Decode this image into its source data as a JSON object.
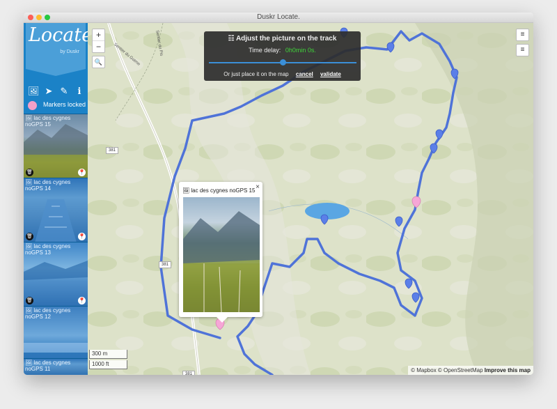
{
  "window": {
    "title": "Duskr Locate."
  },
  "sidebar": {
    "logo_text": "Locate.",
    "logo_by": "by Duskr",
    "tools": [
      {
        "icon": "image-icon",
        "glyph": "🖼"
      },
      {
        "icon": "navigation-icon",
        "glyph": "➤"
      },
      {
        "icon": "pencil-icon",
        "glyph": "✎"
      },
      {
        "icon": "info-icon",
        "glyph": "ℹ"
      }
    ],
    "lock_label": "Markers locked",
    "photos": [
      {
        "caption": "🖼 lac des cygnes noGPS 15"
      },
      {
        "caption": "🖼 lac des cygnes noGPS 14"
      },
      {
        "caption": "🖼 lac des cygnes noGPS 13"
      },
      {
        "caption": "🖼 lac des cygnes noGPS 12"
      },
      {
        "caption": "🖼 lac des cygnes noGPS 11"
      }
    ]
  },
  "map": {
    "zoom_in": "+",
    "zoom_out": "−",
    "search_glyph": "🔍",
    "layer_glyph": "≡",
    "adjust_panel": {
      "heading": "☷ Adjust the picture on the track",
      "time_delay_label": "Time delay:",
      "time_delay_value": "0h0min 0s.",
      "slider_position": 0.5,
      "footer_text": "Or just place it on the map",
      "cancel": "cancel",
      "validate": "validate"
    },
    "popup": {
      "title": "🖼 lac des cygnes noGPS 15",
      "close": "×"
    },
    "scale": {
      "metric": "300 m",
      "imperial": "1000 ft"
    },
    "attribution": {
      "mapbox": "© Mapbox",
      "osm": "© OpenStreetMap",
      "improve": "Improve this map"
    },
    "road_labels": [
      "381",
      "381",
      "381"
    ],
    "place_labels": [
      "Sentier du Gotme",
      "Sentier du Pis"
    ],
    "colors": {
      "track": "#4f73d8",
      "marker": "#5b7fe8",
      "selected_marker": "#f6a6d6",
      "lake": "#5aa6e3"
    }
  }
}
